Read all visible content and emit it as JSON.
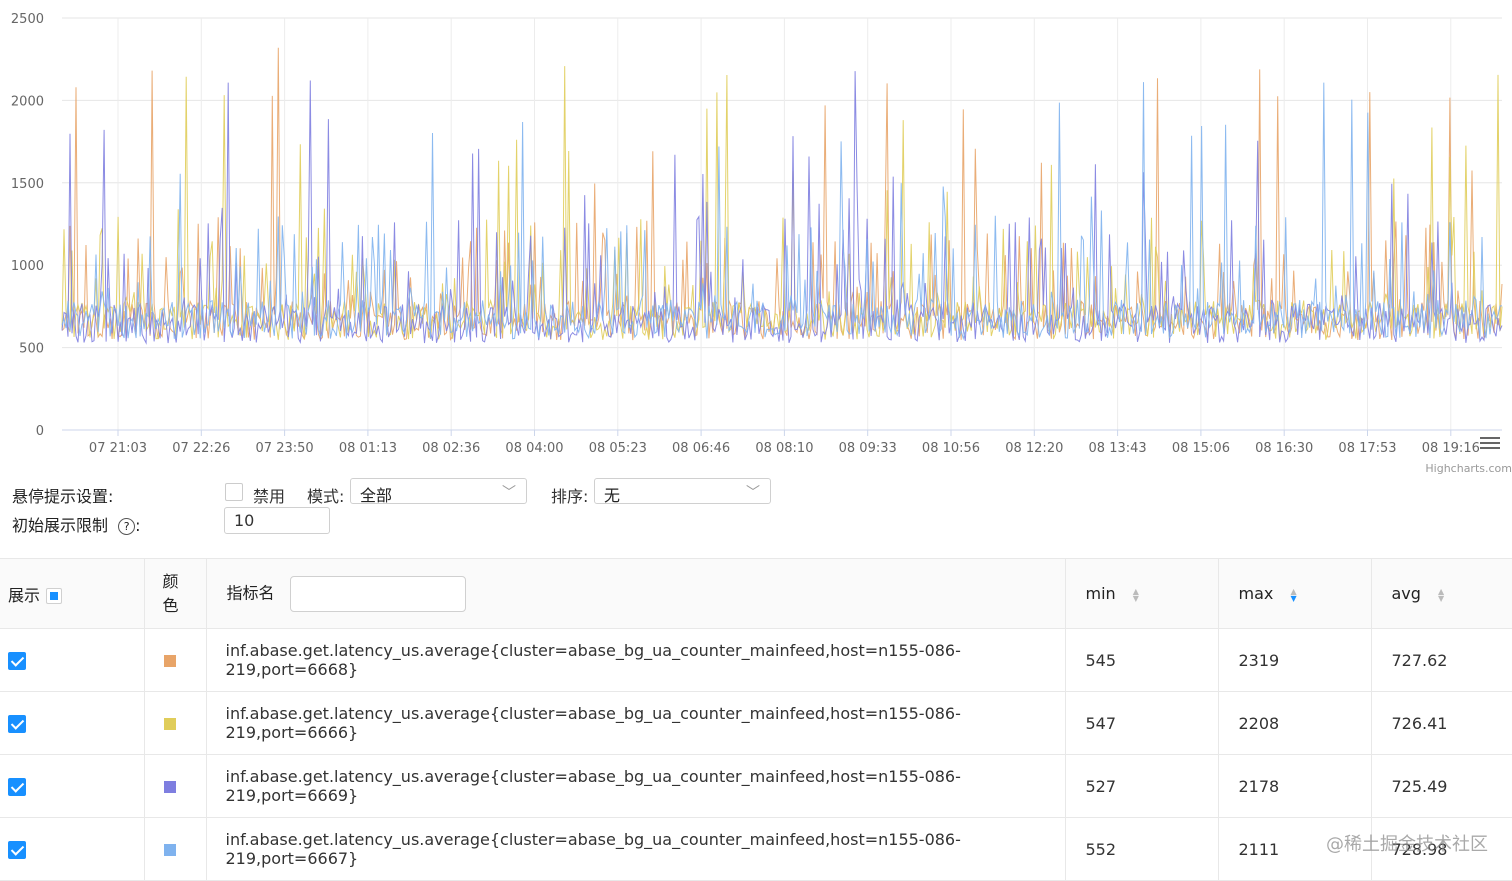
{
  "chart_data": {
    "type": "line",
    "y_ticks": [
      "2500",
      "2000",
      "1500",
      "1000",
      "500",
      "0"
    ],
    "ylim": [
      0,
      2500
    ],
    "x_ticks": [
      "07 21:03",
      "07 22:26",
      "07 23:50",
      "08 01:13",
      "08 02:36",
      "08 04:00",
      "08 05:23",
      "08 06:46",
      "08 08:10",
      "08 09:33",
      "08 10:56",
      "08 12:20",
      "08 13:43",
      "08 15:06",
      "08 16:30",
      "08 17:53",
      "08 19:16"
    ],
    "credits": "Highcharts.com",
    "grid": true,
    "series_colors": [
      "#e8a468",
      "#e0cd5a",
      "#7e7ee0",
      "#7fb2ee"
    ],
    "series_stats": [
      {
        "min": 545,
        "max": 2319,
        "avg": 727.62
      },
      {
        "min": 547,
        "max": 2208,
        "avg": 726.41
      },
      {
        "min": 527,
        "max": 2178,
        "avg": 725.49
      },
      {
        "min": 552,
        "max": 2111,
        "avg": 728.98
      }
    ]
  },
  "settings": {
    "hover_label": "悬停提示设置:",
    "disable_label": "禁用",
    "mode_label": "模式:",
    "mode_value": "全部",
    "sort_label": "排序:",
    "sort_value": "无",
    "limit_label": "初始展示限制",
    "limit_help_icon": "?",
    "limit_colon": ":",
    "limit_value": "10"
  },
  "table": {
    "col_show": "展示",
    "col_color_1": "颜",
    "col_color_2": "色",
    "col_name": "指标名",
    "col_min": "min",
    "col_max": "max",
    "col_avg": "avg",
    "sort_up": "▲",
    "sort_down": "▼",
    "rows": [
      {
        "name": "inf.abase.get.latency_us.average{cluster=abase_bg_ua_counter_mainfeed,host=n155-086-219,port=6668}",
        "min": "545",
        "max": "2319",
        "avg": "727.62",
        "color": "#e8a468"
      },
      {
        "name": "inf.abase.get.latency_us.average{cluster=abase_bg_ua_counter_mainfeed,host=n155-086-219,port=6666}",
        "min": "547",
        "max": "2208",
        "avg": "726.41",
        "color": "#e0cd5a"
      },
      {
        "name": "inf.abase.get.latency_us.average{cluster=abase_bg_ua_counter_mainfeed,host=n155-086-219,port=6669}",
        "min": "527",
        "max": "2178",
        "avg": "725.49",
        "color": "#7e7ee0"
      },
      {
        "name": "inf.abase.get.latency_us.average{cluster=abase_bg_ua_counter_mainfeed,host=n155-086-219,port=6667}",
        "min": "552",
        "max": "2111",
        "avg": "728.98",
        "color": "#7fb2ee"
      }
    ]
  },
  "watermark": "@稀土掘金技术社区"
}
